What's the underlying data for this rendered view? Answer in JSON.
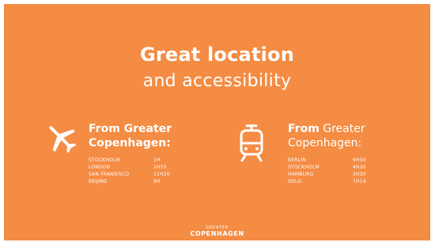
{
  "slide": {
    "title_bold": "Great location",
    "title_light": "and accessibility",
    "background_color": "#F48C43"
  },
  "left": {
    "icon": "airplane-icon",
    "heading_line1": "From Greater",
    "heading_line2": "Copenhagen:",
    "rows": [
      {
        "city": "STOCKHOLM",
        "duration": "1H"
      },
      {
        "city": "LONDON",
        "duration": "1H55"
      },
      {
        "city": "SAN FRANSISCO",
        "duration": "11H20"
      },
      {
        "city": "BEIJING",
        "duration": "9H"
      }
    ]
  },
  "right": {
    "icon": "train-icon",
    "heading_strong": "From",
    "heading_line1_rest": " Greater",
    "heading_line2": "Copenhagen:",
    "rows": [
      {
        "city": "BERLIN",
        "duration": "6H50"
      },
      {
        "city": "STOCKHOLM",
        "duration": "4H20"
      },
      {
        "city": "HAMBURG",
        "duration": "5H30"
      },
      {
        "city": "OSLO",
        "duration": "7H14"
      }
    ]
  },
  "logo": {
    "top": "GREATER",
    "main": "COPENHAGEN"
  }
}
